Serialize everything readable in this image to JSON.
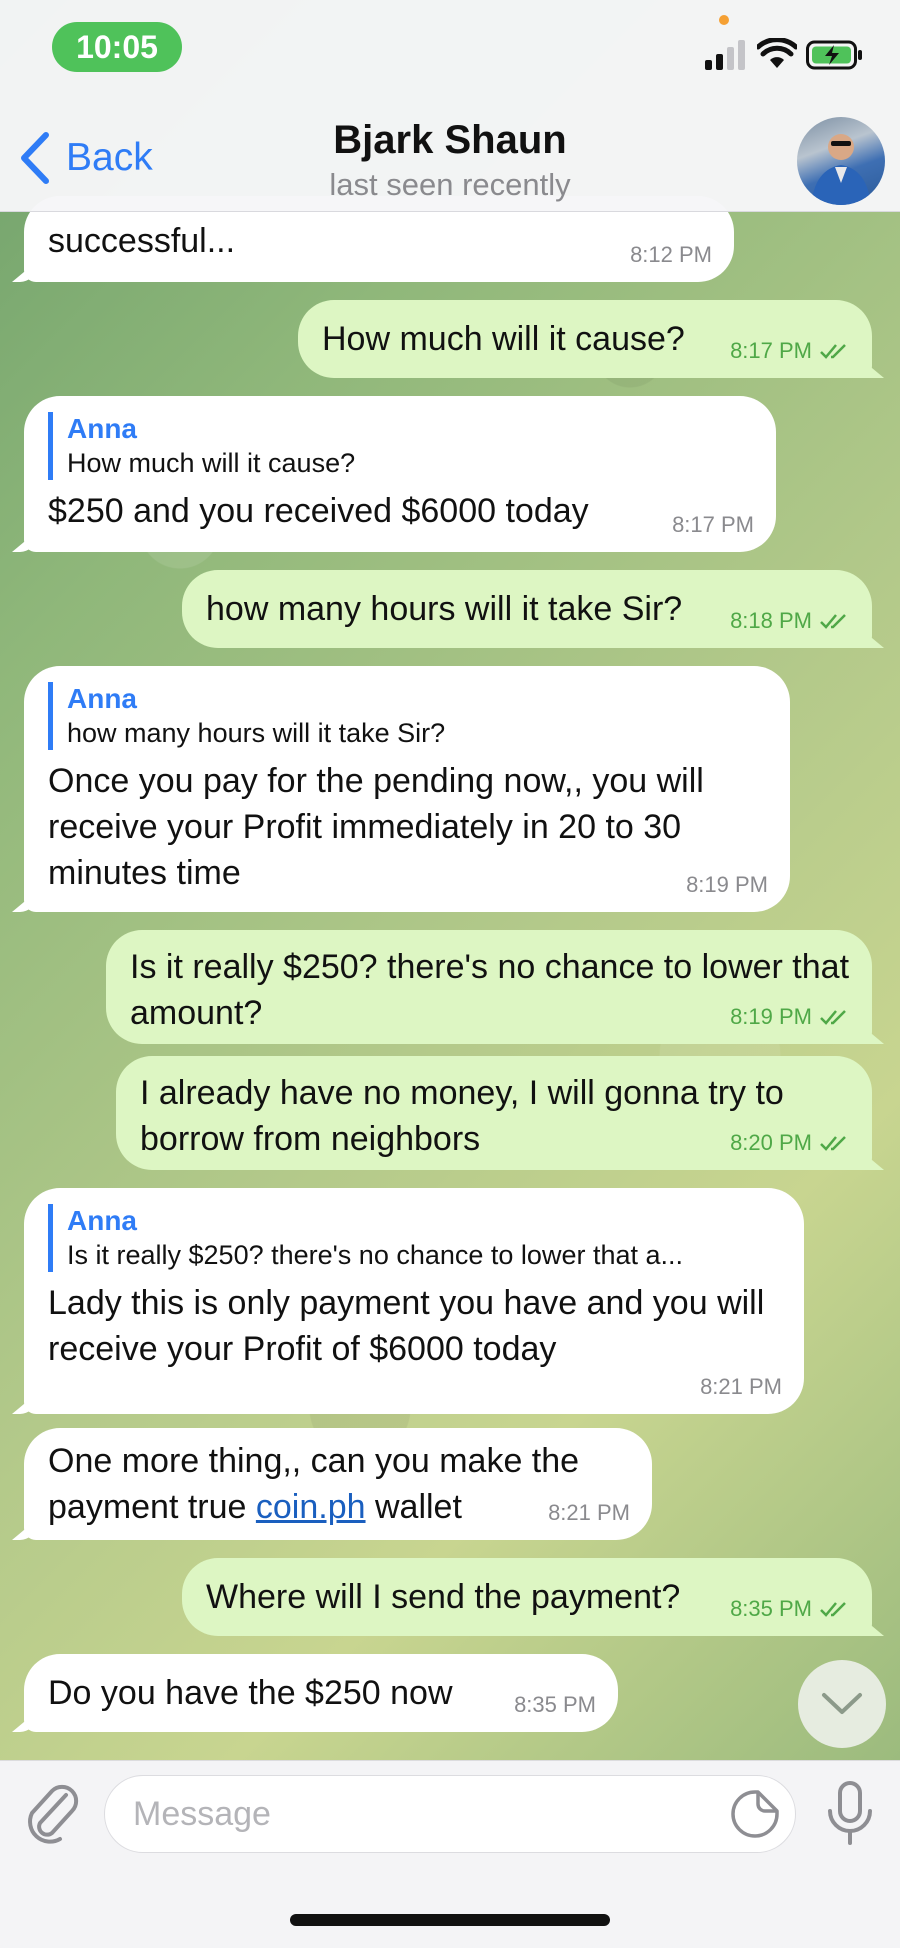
{
  "status_bar": {
    "time": "10:05"
  },
  "header": {
    "back_label": "Back",
    "title": "Bjark Shaun",
    "subtitle": "last seen recently"
  },
  "messages": [
    {
      "direction": "in",
      "text": "successful...",
      "time": "8:12 PM"
    },
    {
      "direction": "out",
      "text": "How much will it cause?",
      "time": "8:17 PM",
      "status": "read"
    },
    {
      "direction": "in",
      "reply_name": "Anna",
      "reply_text": "How much will it cause?",
      "text": "$250 and you received $6000 today",
      "time": "8:17 PM"
    },
    {
      "direction": "out",
      "text": "how many hours will it take Sir?",
      "time": "8:18 PM",
      "status": "read"
    },
    {
      "direction": "in",
      "reply_name": "Anna",
      "reply_text": "how many hours will it take Sir?",
      "text": "Once you pay for the pending now,, you will receive your Profit immediately in 20 to 30 minutes time",
      "time": "8:19 PM"
    },
    {
      "direction": "out",
      "text": "Is it really $250? there's no chance to lower that amount?",
      "time": "8:19 PM",
      "status": "read"
    },
    {
      "direction": "out",
      "text": "I already have no money,  I will gonna try to borrow from neighbors",
      "time": "8:20 PM",
      "status": "read"
    },
    {
      "direction": "in",
      "reply_name": "Anna",
      "reply_text": "Is it really $250? there's no chance to lower that a...",
      "text": "Lady this is only payment you have and you will receive your Profit of $6000 today",
      "time": "8:21 PM"
    },
    {
      "direction": "in",
      "text_before": "One more thing,, can you make the payment true ",
      "link": "coin.ph",
      "text_after": " wallet",
      "time": "8:21 PM"
    },
    {
      "direction": "out",
      "text": "Where will I send the payment?",
      "time": "8:35 PM",
      "status": "read"
    },
    {
      "direction": "in",
      "text": "Do you have the $250 now",
      "time": "8:35 PM"
    }
  ],
  "composer": {
    "placeholder": "Message"
  },
  "icons": {
    "back": "chevron-left-icon",
    "attach": "paperclip-icon",
    "sticker": "sticker-icon",
    "mic": "microphone-icon",
    "scroll": "chevron-down-icon",
    "read_status": "double-check-icon"
  },
  "colors": {
    "accent": "#2f7cf6",
    "incoming_bubble": "#ffffff",
    "outgoing_bubble": "#ddf6c3",
    "time_pill": "#4fc25a"
  }
}
